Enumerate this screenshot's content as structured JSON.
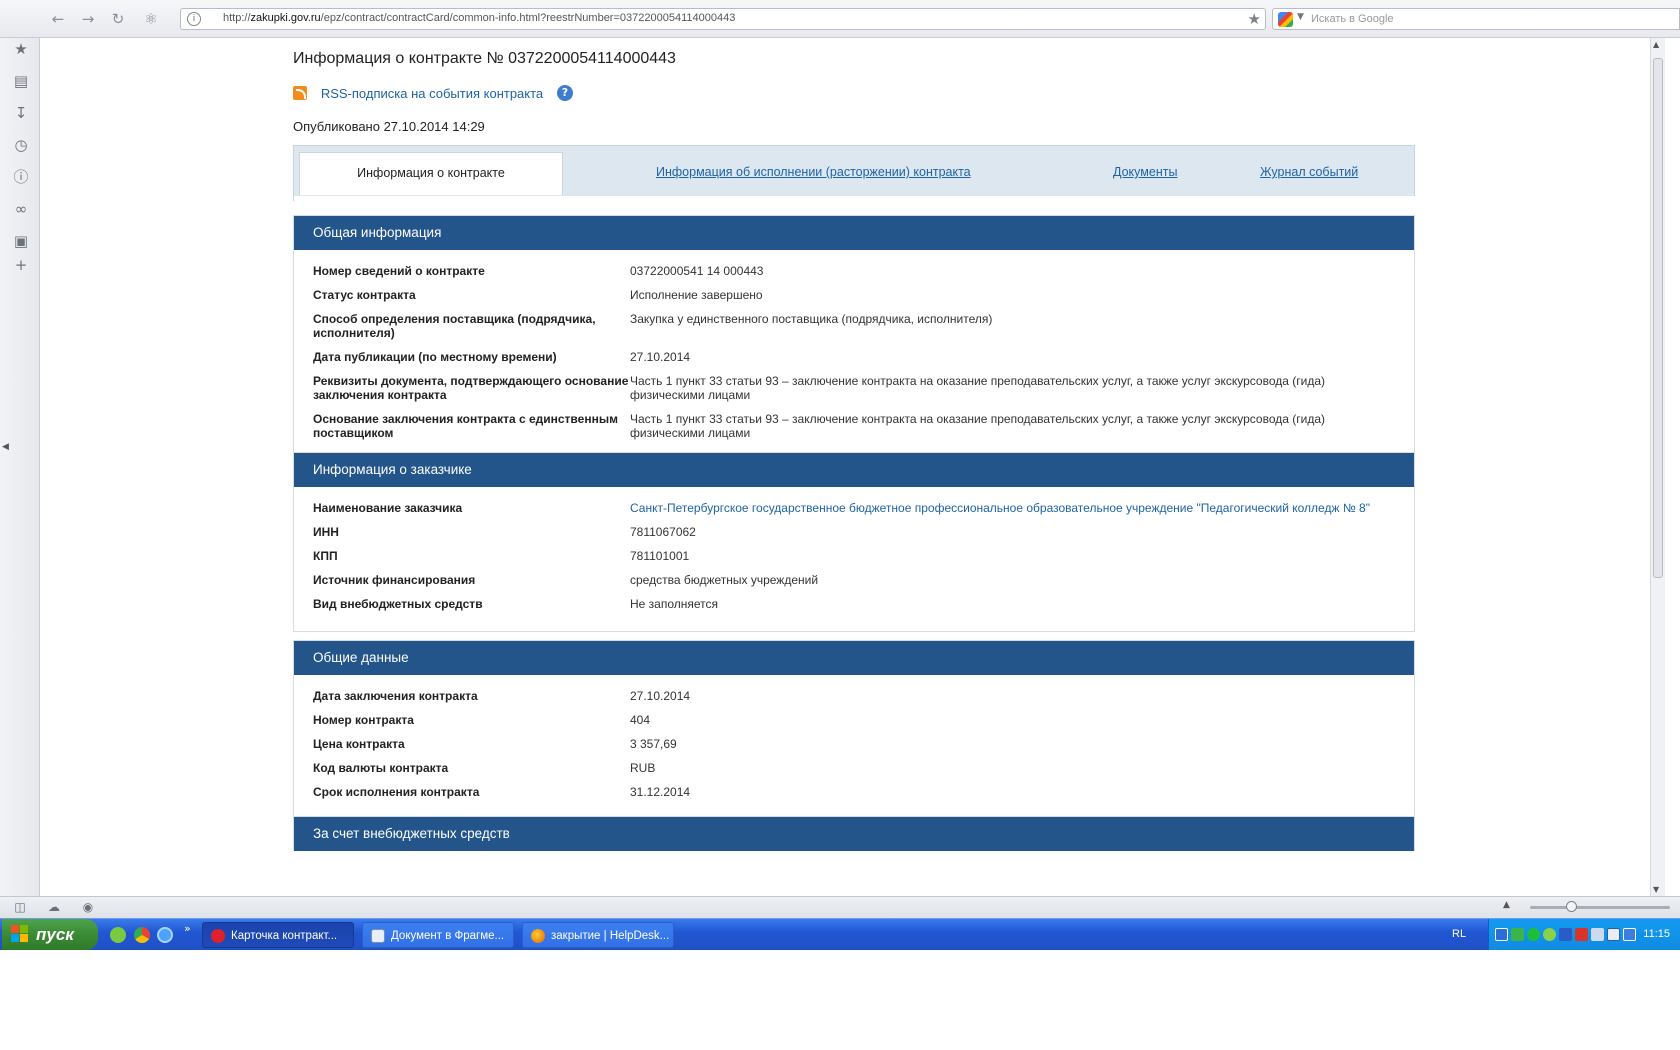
{
  "browser": {
    "url_prefix": "http://",
    "url_host": "zakupki.gov.ru",
    "url_path": "/epz/contract/contractCard/common-info.html?reestrNumber=0372200054114000443",
    "search_placeholder": "Искать в Google"
  },
  "page": {
    "title": "Информация о контракте № 0372200054114000443",
    "rss_label": "RSS-подписка на события контракта",
    "help_glyph": "?",
    "published": "Опубликовано 27.10.2014 14:29"
  },
  "tabs": [
    {
      "label": "Информация о контракте",
      "active": true
    },
    {
      "label": "Информация об исполнении (расторжении) контракта",
      "active": false
    },
    {
      "label": "Документы",
      "active": false
    },
    {
      "label": "Журнал событий",
      "active": false
    }
  ],
  "sections": {
    "general": {
      "title": "Общая информация",
      "rows": [
        {
          "label": "Номер сведений о контракте",
          "value": "03722000541 14 000443"
        },
        {
          "label": "Статус контракта",
          "value": "Исполнение завершено"
        },
        {
          "label": "Способ определения поставщика (подрядчика, исполнителя)",
          "value": "Закупка у единственного поставщика (подрядчика, исполнителя)"
        },
        {
          "label": "Дата публикации (по местному времени)",
          "value": "27.10.2014"
        },
        {
          "label": "Реквизиты документа, подтверждающего основание заключения контракта",
          "value": "Часть 1 пункт 33 статьи 93 – заключение контракта на оказание преподавательских услуг, а также услуг экскурсовода (гида) физическими лицами"
        },
        {
          "label": "Основание заключения контракта с единственным поставщиком",
          "value": "Часть 1 пункт 33 статьи 93 – заключение контракта на оказание преподавательских услуг, а также услуг экскурсовода (гида) физическими лицами"
        }
      ]
    },
    "customer": {
      "title": "Информация о заказчике",
      "rows": [
        {
          "label": "Наименование заказчика",
          "value": "Санкт-Петербургское государственное бюджетное профессиональное образовательное учреждение \"Педагогический колледж № 8\""
        },
        {
          "label": "ИНН",
          "value": "7811067062"
        },
        {
          "label": "КПП",
          "value": "781101001"
        },
        {
          "label": "Источник финансирования",
          "value": "средства бюджетных учреждений"
        },
        {
          "label": "Вид внебюджетных средств",
          "value": "Не заполняется"
        }
      ]
    },
    "common": {
      "title": "Общие данные",
      "rows": [
        {
          "label": "Дата заключения контракта",
          "value": "27.10.2014"
        },
        {
          "label": "Номер контракта",
          "value": "404"
        },
        {
          "label": "Цена контракта",
          "value": "3 357,69"
        },
        {
          "label": "Код валюты контракта",
          "value": "RUB"
        },
        {
          "label": "Срок исполнения контракта",
          "value": "31.12.2014"
        }
      ]
    },
    "extrabudget": {
      "title": "За счет внебюджетных средств"
    }
  },
  "taskbar": {
    "start_label": "пуск",
    "buttons": [
      {
        "label": "Карточка контракт...",
        "icon": "opera-icon"
      },
      {
        "label": "Документ в Фрагме...",
        "icon": "document-icon"
      },
      {
        "label": "закрытие | HelpDesk...",
        "icon": "firefox-icon"
      }
    ],
    "chevron": "»",
    "language": "RL",
    "clock": "11:15"
  },
  "colors": {
    "section_header": "#23558a",
    "link": "#1e63a6",
    "tabs_bg": "#dde7ef"
  }
}
